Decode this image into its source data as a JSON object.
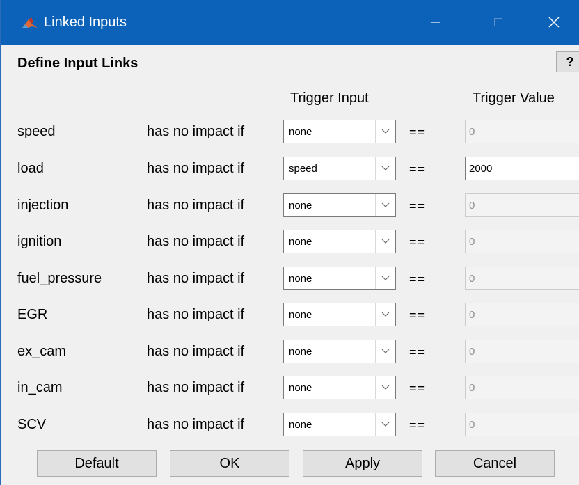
{
  "window": {
    "title": "Linked Inputs",
    "app_icon": "matlab-icon",
    "controls": [
      "minimize-icon",
      "maximize-icon",
      "close-icon"
    ]
  },
  "panel": {
    "title": "Define Input Links",
    "help_label": "?"
  },
  "table": {
    "headers": {
      "trigger_input": "Trigger Input",
      "trigger_value": "Trigger Value"
    },
    "rows": [
      {
        "name": "speed",
        "condition": "has no impact if",
        "trigger_input": "none",
        "operator": "==",
        "trigger_value": "0",
        "value_enabled": false
      },
      {
        "name": "load",
        "condition": "has no impact if",
        "trigger_input": "speed",
        "operator": "==",
        "trigger_value": "2000",
        "value_enabled": true
      },
      {
        "name": "injection",
        "condition": "has no impact if",
        "trigger_input": "none",
        "operator": "==",
        "trigger_value": "0",
        "value_enabled": false
      },
      {
        "name": "ignition",
        "condition": "has no impact if",
        "trigger_input": "none",
        "operator": "==",
        "trigger_value": "0",
        "value_enabled": false
      },
      {
        "name": "fuel_pressure",
        "condition": "has no impact if",
        "trigger_input": "none",
        "operator": "==",
        "trigger_value": "0",
        "value_enabled": false
      },
      {
        "name": "EGR",
        "condition": "has no impact if",
        "trigger_input": "none",
        "operator": "==",
        "trigger_value": "0",
        "value_enabled": false
      },
      {
        "name": "ex_cam",
        "condition": "has no impact if",
        "trigger_input": "none",
        "operator": "==",
        "trigger_value": "0",
        "value_enabled": false
      },
      {
        "name": "in_cam",
        "condition": "has no impact if",
        "trigger_input": "none",
        "operator": "==",
        "trigger_value": "0",
        "value_enabled": false
      },
      {
        "name": "SCV",
        "condition": "has no impact if",
        "trigger_input": "none",
        "operator": "==",
        "trigger_value": "0",
        "value_enabled": false
      }
    ]
  },
  "buttons": {
    "default_label": "Default",
    "ok_label": "OK",
    "apply_label": "Apply",
    "cancel_label": "Cancel"
  },
  "colors": {
    "titlebar": "#0b62b8",
    "background": "#f0f0f0",
    "disabled_field": "#f3f3f3"
  }
}
